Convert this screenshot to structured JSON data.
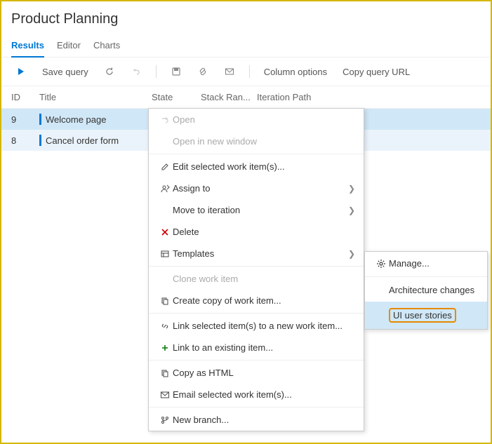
{
  "header": {
    "title": "Product Planning"
  },
  "tabs": {
    "results": "Results",
    "editor": "Editor",
    "charts": "Charts"
  },
  "toolbar": {
    "save_query": "Save query",
    "column_options": "Column options",
    "copy_query_url": "Copy query URL"
  },
  "columns": {
    "id": "ID",
    "title": "Title",
    "state": "State",
    "stack_rank": "Stack Ran...",
    "iteration_path": "Iteration Path"
  },
  "rows": [
    {
      "id": "9",
      "title": "Welcome page"
    },
    {
      "id": "8",
      "title": "Cancel order form"
    }
  ],
  "context_menu": {
    "open": "Open",
    "open_new_window": "Open in new window",
    "edit_selected": "Edit selected work item(s)...",
    "assign_to": "Assign to",
    "move_to_iteration": "Move to iteration",
    "delete": "Delete",
    "templates": "Templates",
    "clone_work_item": "Clone work item",
    "create_copy": "Create copy of work item...",
    "link_new": "Link selected item(s) to a new work item...",
    "link_existing": "Link to an existing item...",
    "copy_html": "Copy as HTML",
    "email_selected": "Email selected work item(s)...",
    "new_branch": "New branch..."
  },
  "submenu": {
    "manage": "Manage...",
    "architecture_changes": "Architecture changes",
    "ui_user_stories": "UI user stories"
  }
}
